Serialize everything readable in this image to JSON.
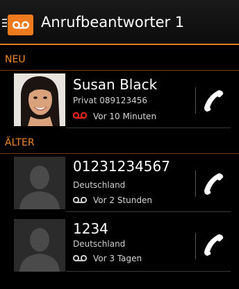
{
  "header": {
    "title": "Anrufbeantworter 1"
  },
  "sections": {
    "new_label": "NEU",
    "older_label": "ÄLTER"
  },
  "messages": [
    {
      "name": "Susan Black",
      "subtitle": "Privat 089123456",
      "time": "Vor 10 Minuten",
      "status": "new",
      "has_photo": true,
      "voicemail_icon": "voicemail-icon",
      "voicemail_color": "#e0241c"
    },
    {
      "name": "01231234567",
      "subtitle": "Deutschland",
      "time": "Vor 2 Stunden",
      "status": "older",
      "has_photo": false,
      "voicemail_icon": "voicemail-icon",
      "voicemail_color": "#cfcfcf"
    },
    {
      "name": "1234",
      "subtitle": "Deutschland",
      "time": "Vor 3 Tagen",
      "status": "older",
      "has_photo": false,
      "voicemail_icon": "voicemail-icon",
      "voicemail_color": "#cfcfcf"
    }
  ],
  "colors": {
    "accent": "#f07b1f",
    "section_text": "#f08a2c",
    "background": "#000000"
  },
  "icons": {
    "menu": "menu-icon",
    "app": "voicemail-app-icon",
    "call": "phone-handset-icon",
    "placeholder_avatar": "person-silhouette-icon"
  }
}
